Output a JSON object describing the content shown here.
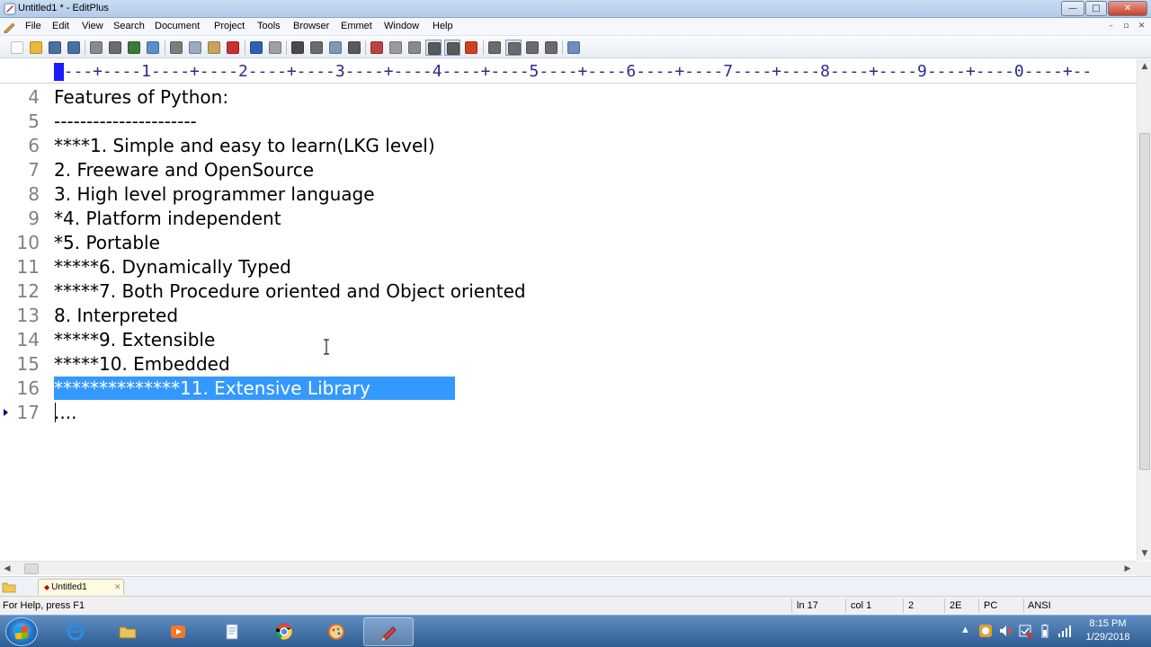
{
  "window": {
    "title": "Untitled1 * - EditPlus",
    "minimize_glyph": "—",
    "maximize_glyph": "□",
    "close_glyph": "✕"
  },
  "menu": {
    "items": [
      "File",
      "Edit",
      "View",
      "Search",
      "Document",
      "Project",
      "Tools",
      "Browser",
      "Emmet",
      "Window",
      "Help"
    ],
    "mdi_min": "–",
    "mdi_restore": "▫",
    "mdi_close": "✕"
  },
  "toolbar": {
    "buttons": [
      {
        "icon": "new-file-icon",
        "color": "#ffffff"
      },
      {
        "icon": "open-folder-icon",
        "color": "#e8b93a"
      },
      {
        "icon": "save-icon",
        "color": "#4a6fa5"
      },
      {
        "icon": "save-all-icon",
        "color": "#4a6fa5"
      },
      {
        "icon": "print-preview-icon",
        "color": "#8a8a8a"
      },
      {
        "icon": "print-icon",
        "color": "#6b6b6b"
      },
      {
        "icon": "spell-check-icon",
        "color": "#3a7a3a"
      },
      {
        "icon": "browser-icon",
        "color": "#5a8fcf"
      },
      {
        "icon": "cut-icon",
        "color": "#7c7c7c"
      },
      {
        "icon": "copy-icon",
        "color": "#9aa9bf"
      },
      {
        "icon": "paste-icon",
        "color": "#c9a45a"
      },
      {
        "icon": "delete-icon",
        "color": "#c83030"
      },
      {
        "icon": "undo-icon",
        "color": "#2f5fb3"
      },
      {
        "icon": "redo-icon",
        "color": "#a0a0a0"
      },
      {
        "icon": "find-icon",
        "color": "#4a4a4a"
      },
      {
        "icon": "replace-icon",
        "color": "#6b6b6b"
      },
      {
        "icon": "find-in-files-icon",
        "color": "#7f97b8"
      },
      {
        "icon": "goto-line-icon",
        "color": "#5a5a5a"
      },
      {
        "icon": "font-icon",
        "color": "#c04040"
      },
      {
        "icon": "hex-icon",
        "color": "#9a9a9a"
      },
      {
        "icon": "word-wrap-icon",
        "color": "#8a8a8a"
      },
      {
        "icon": "line-number-icon",
        "color": "#5a5a5a"
      },
      {
        "icon": "ruler-icon",
        "color": "#5a5a5a"
      },
      {
        "icon": "check-icon",
        "color": "#d04020"
      },
      {
        "icon": "cliptext-icon",
        "color": "#6b6b6b"
      },
      {
        "icon": "directory-icon",
        "color": "#6b6b6b"
      },
      {
        "icon": "output-window-icon",
        "color": "#6b6b6b"
      },
      {
        "icon": "tile-icon",
        "color": "#6b6b6b"
      },
      {
        "icon": "help-context-icon",
        "color": "#6b8fbf"
      }
    ]
  },
  "ruler": {
    "text": "----+----1----+----2----+----3----+----4----+----5----+----6----+----7----+----8----+----9----+----0----+--"
  },
  "editor": {
    "lines": [
      {
        "num": "4",
        "text": "Features of Python:"
      },
      {
        "num": "5",
        "text": "----------------------"
      },
      {
        "num": "6",
        "text": "****1. Simple and easy to learn(LKG level)"
      },
      {
        "num": "7",
        "text": "2. Freeware and OpenSource"
      },
      {
        "num": "8",
        "text": "3. High level programmer language"
      },
      {
        "num": "9",
        "text": "*4. Platform independent"
      },
      {
        "num": "10",
        "text": "*5. Portable"
      },
      {
        "num": "11",
        "text": "*****6. Dynamically Typed"
      },
      {
        "num": "12",
        "text": "*****7. Both Procedure oriented and Object oriented"
      },
      {
        "num": "13",
        "text": "8. Interpreted"
      },
      {
        "num": "14",
        "text": "*****9. Extensible"
      },
      {
        "num": "15",
        "text": "*****10. Embedded"
      },
      {
        "num": "16",
        "text": "**************11. Extensive Library"
      },
      {
        "num": "17",
        "text": "...."
      }
    ],
    "selection_color": "#3399ff"
  },
  "tabs": [
    {
      "label": "Untitled1",
      "modified_mark": "◆",
      "close_glyph": "✕"
    }
  ],
  "status": {
    "help": "For Help, press F1",
    "line": "ln 17",
    "col": "col 1",
    "tab_size": "2",
    "code": "2E",
    "line_ending": "PC",
    "encoding": "ANSI"
  },
  "taskbar": {
    "apps": [
      {
        "icon": "internet-explorer-icon",
        "color": "#2a8ee0"
      },
      {
        "icon": "file-explorer-icon",
        "color": "#e8c45a"
      },
      {
        "icon": "media-player-icon",
        "color": "#f07a2a"
      },
      {
        "icon": "notepad-app-icon",
        "color": "#7aa2d6"
      },
      {
        "icon": "chrome-icon",
        "color": "#dd4b39"
      },
      {
        "icon": "paint-app-icon",
        "color": "#e0703a"
      },
      {
        "icon": "editplus-app-icon",
        "color": "#d04545"
      }
    ],
    "time": "8:15 PM",
    "date": "1/29/2018"
  }
}
